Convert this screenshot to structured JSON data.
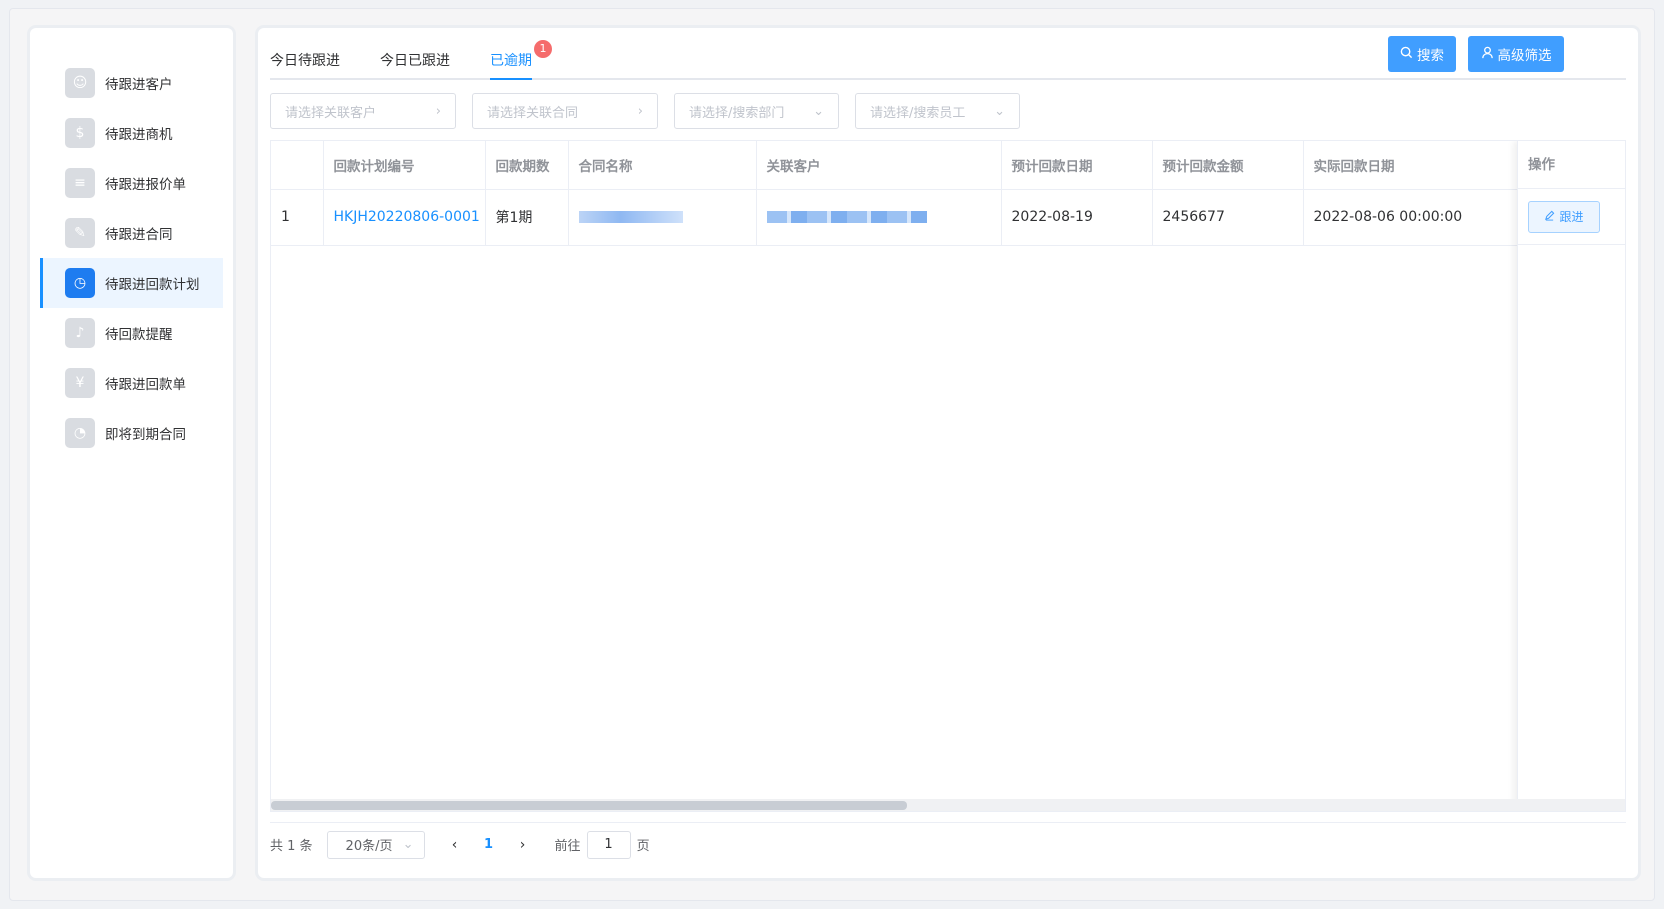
{
  "sidebar": {
    "items": [
      {
        "label": "待跟进客户",
        "icon": "user-group-icon",
        "glyph": "☺"
      },
      {
        "label": "待跟进商机",
        "icon": "dollar-doc-icon",
        "glyph": "$"
      },
      {
        "label": "待跟进报价单",
        "icon": "quote-doc-icon",
        "glyph": "≡"
      },
      {
        "label": "待跟进合同",
        "icon": "contract-doc-icon",
        "glyph": "✎"
      },
      {
        "label": "待跟进回款计划",
        "icon": "payment-plan-icon",
        "glyph": "◷",
        "active": true
      },
      {
        "label": "待回款提醒",
        "icon": "bell-icon",
        "glyph": "♪"
      },
      {
        "label": "待跟进回款单",
        "icon": "money-bag-icon",
        "glyph": "¥"
      },
      {
        "label": "即将到期合同",
        "icon": "clock-icon",
        "glyph": "◔"
      }
    ]
  },
  "tabs": [
    {
      "label": "今日待跟进"
    },
    {
      "label": "今日已跟进"
    },
    {
      "label": "已逾期",
      "badge": "1",
      "active": true
    }
  ],
  "toolbar": {
    "search_label": "搜索",
    "advanced_label": "高级筛选"
  },
  "filters": {
    "customer_placeholder": "请选择关联客户",
    "contract_placeholder": "请选择关联合同",
    "department_placeholder": "请选择/搜索部门",
    "employee_placeholder": "请选择/搜索员工"
  },
  "table": {
    "columns": [
      "",
      "回款计划编号",
      "回款期数",
      "合同名称",
      "关联客户",
      "预计回款日期",
      "预计回款金额",
      "实际回款日期",
      "操作"
    ],
    "rows": [
      {
        "index": "1",
        "plan_no": "HKJH20220806-0001",
        "period": "第1期",
        "expected_date": "2022-08-19",
        "expected_amount": "2456677",
        "actual_date": "2022-08-06 00:00:00",
        "action": "跟进"
      }
    ]
  },
  "pagination": {
    "total": "共 1 条",
    "page_size": "20条/页",
    "current_page": "1",
    "goto_label": "前往",
    "goto_value": "1",
    "page_suffix": "页"
  },
  "colors": {
    "accent": "#1890ff",
    "badge": "#f56c6c",
    "button": "#409eff"
  }
}
